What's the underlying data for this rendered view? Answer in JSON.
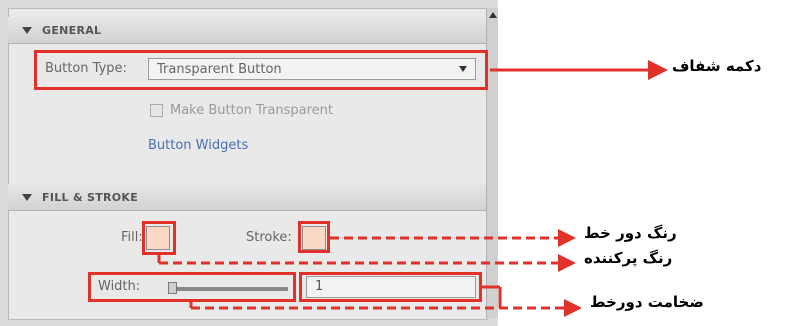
{
  "general": {
    "header": "GENERAL",
    "button_type_label": "Button Type:",
    "button_type_value": "Transparent Button",
    "make_transparent_label": "Make Button Transparent",
    "widgets_link": "Button Widgets"
  },
  "fill_stroke": {
    "header": "FILL & STROKE",
    "fill_label": "Fill:",
    "stroke_label": "Stroke:",
    "width_label": "Width:",
    "width_value": "1",
    "swatch_color": "#fbd8c4"
  },
  "annotations": {
    "transparent_button": "دکمه شفاف",
    "stroke_color": "رنگ دور خط",
    "fill_color": "رنگ پرکننده",
    "stroke_width": "ضخامت دورخط",
    "accent_color": "#e0322b"
  }
}
